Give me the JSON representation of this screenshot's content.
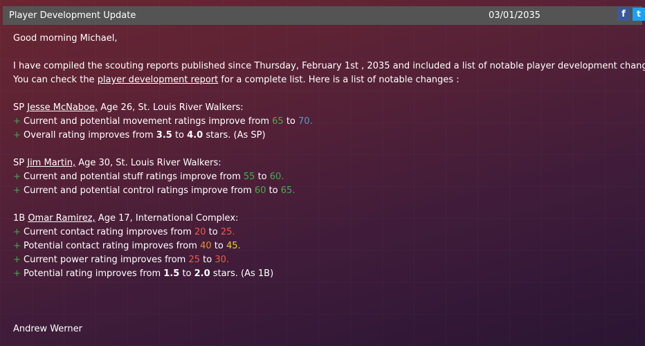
{
  "header": {
    "title": "Player Development Update",
    "date": "03/01/2035",
    "facebook_icon": "f",
    "twitter_icon": "t"
  },
  "body": {
    "greeting": "Good morning Michael,",
    "intro_1": "I have compiled the scouting reports published since Thursday, February 1st , 2035 and included a list of notable player development changes.",
    "intro_2_pre": "You can check the ",
    "intro_2_link": "player development report",
    "intro_2_post": " for a complete list. Here is a list of notable changes :",
    "signature": "Andrew Werner"
  },
  "players": [
    {
      "position": "SP ",
      "name": "Jesse McNaboe,",
      "details": " Age 26, St. Louis River Walkers:",
      "changes": [
        {
          "plus": "+ ",
          "text": "Current and potential movement ratings improve from ",
          "from": "65",
          "to_word": " to ",
          "to": "70.",
          "suffix": ""
        },
        {
          "plus": "+ ",
          "text": "Overall rating improves from ",
          "from": "3.5",
          "to_word": " to ",
          "to": "4.0",
          "suffix": " stars. (As SP)"
        }
      ]
    },
    {
      "position": "SP ",
      "name": "Jim Martin,",
      "details": " Age 30, St. Louis River Walkers:",
      "changes": [
        {
          "plus": "+ ",
          "text": "Current and potential stuff ratings improve from ",
          "from": "55",
          "to_word": " to ",
          "to": "60.",
          "suffix": ""
        },
        {
          "plus": "+ ",
          "text": "Current and potential control ratings improve from ",
          "from": "60",
          "to_word": " to ",
          "to": "65.",
          "suffix": ""
        }
      ]
    },
    {
      "position": "1B ",
      "name": "Omar Ramirez,",
      "details": " Age 17, International Complex:",
      "changes": [
        {
          "plus": "+ ",
          "text": "Current contact rating improves from ",
          "from": "20",
          "to_word": " to ",
          "to": "25.",
          "suffix": ""
        },
        {
          "plus": "+ ",
          "text": "Potential contact rating improves from ",
          "from": "40",
          "to_word": " to ",
          "to": "45.",
          "suffix": ""
        },
        {
          "plus": "+ ",
          "text": "Current power rating improves from ",
          "from": "25",
          "to_word": " to ",
          "to": "30.",
          "suffix": ""
        },
        {
          "plus": "+ ",
          "text": "Potential rating improves from ",
          "from": "1.5",
          "to_word": " to ",
          "to": "2.0",
          "suffix": " stars. (As 1B)"
        }
      ]
    }
  ],
  "colors": {
    "header_bg": "#555455",
    "plus": "#41a84c",
    "green": "#44ae4c",
    "teal": "#4ba1c0",
    "red": "#e85c4e",
    "orange": "#e8902a",
    "yellow": "#ead325"
  }
}
